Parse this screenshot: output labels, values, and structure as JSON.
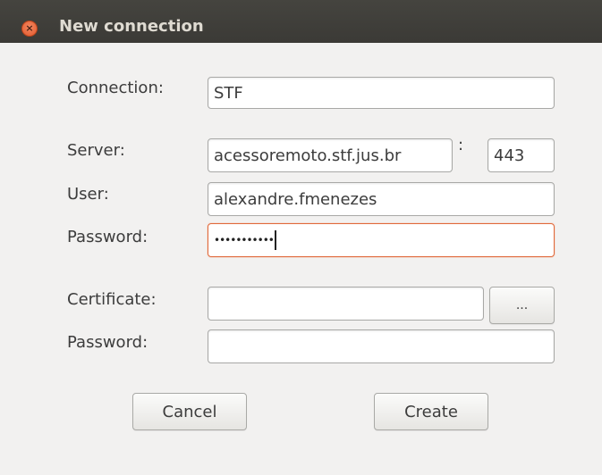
{
  "window": {
    "title": "New connection",
    "close_symbol": "×"
  },
  "form": {
    "connection_label": "Connection:",
    "connection_value": "STF",
    "server_label": "Server:",
    "server_value": "acessoremoto.stf.jus.br",
    "port_separator": ":",
    "port_value": "443",
    "user_label": "User:",
    "user_value": "alexandre.fmenezes",
    "password_label": "Password:",
    "password_value_masked": "•••••••••••",
    "certificate_label": "Certificate:",
    "certificate_value": "",
    "browse_label": "...",
    "cert_password_label": "Password:",
    "cert_password_value": ""
  },
  "buttons": {
    "cancel_label": "Cancel",
    "create_label": "Create"
  },
  "colors": {
    "titlebar": "#3c3b37",
    "close_button": "#e95e31",
    "focus_border": "#e0683a",
    "window_background": "#f2f1f0"
  }
}
